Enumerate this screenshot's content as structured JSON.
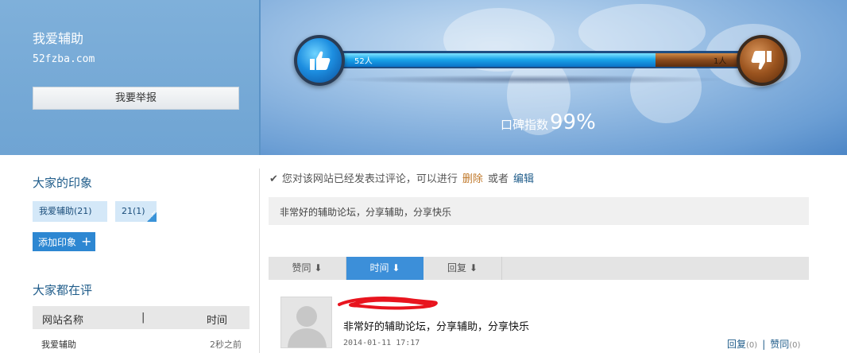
{
  "site": {
    "name": "我爱辅助",
    "url": "52fzba.com",
    "report_label": "我要举报"
  },
  "vote": {
    "like_count": "52人",
    "dislike_count": "1人",
    "score_label": "口碑指数",
    "score_value": "99%",
    "like_share": 0.98
  },
  "impressions": {
    "title": "大家的印象",
    "tags": [
      {
        "label": "我爱辅助(21)"
      },
      {
        "label": "21(1)"
      }
    ],
    "add_label": "添加印象"
  },
  "reviewing": {
    "title": "大家都在评",
    "columns": [
      "网站名称",
      "|",
      "时间"
    ],
    "rows": [
      {
        "name": "我爱辅助",
        "time": "2秒之前"
      }
    ]
  },
  "notice": {
    "text": "您对该网站已经发表过评论，可以进行",
    "delete_label": "删除",
    "or": "或者",
    "edit_label": "编辑"
  },
  "my_comment": "非常好的辅助论坛，分享辅助，分享快乐",
  "sort_tabs": [
    {
      "label": "赞同",
      "arrow": "⬇"
    },
    {
      "label": "时间",
      "arrow": "⬇",
      "active": true
    },
    {
      "label": "回复",
      "arrow": "⬇"
    }
  ],
  "review": {
    "text": "非常好的辅助论坛，分享辅助，分享快乐",
    "time": "2014-01-11 17:17",
    "reply_label": "回复",
    "reply_count": "(0)",
    "sep": "|",
    "agree_label": "赞同",
    "agree_count": "(0)"
  },
  "colors": {
    "accent": "#3c8fd9",
    "title_blue": "#1f5c8a",
    "delete": "#c0782a"
  }
}
